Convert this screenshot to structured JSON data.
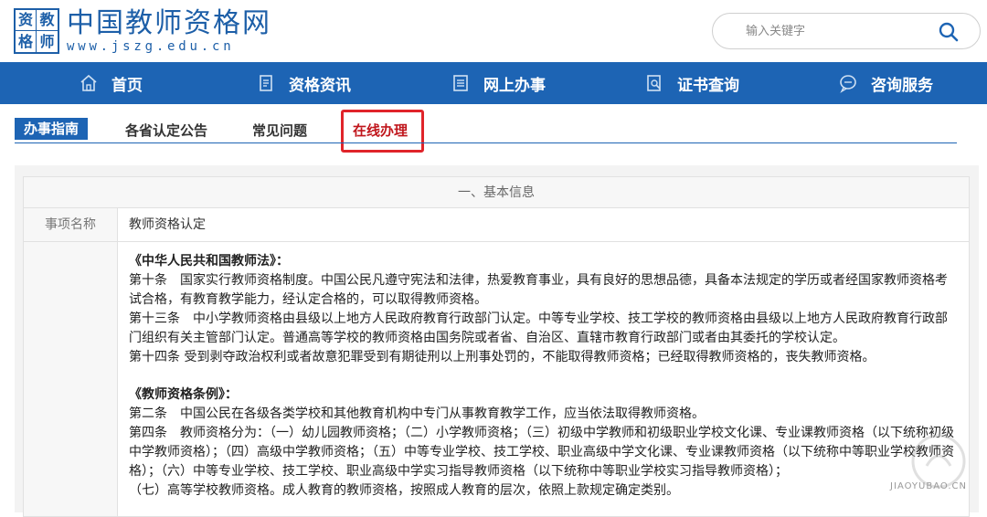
{
  "header": {
    "logo_chars": [
      "资",
      "教",
      "格",
      "师"
    ],
    "site_title": "中国教师资格网",
    "site_url": "www.jszg.edu.cn",
    "search_placeholder": "输入关键字"
  },
  "nav": {
    "items": [
      {
        "label": "首页",
        "icon": "home-icon"
      },
      {
        "label": "资格资讯",
        "icon": "document-icon"
      },
      {
        "label": "网上办事",
        "icon": "list-icon"
      },
      {
        "label": "证书查询",
        "icon": "search-document-icon"
      },
      {
        "label": "咨询服务",
        "icon": "chat-icon"
      }
    ]
  },
  "subtabs": {
    "items": [
      "办事指南",
      "各省认定公告",
      "常见问题",
      "在线办理"
    ],
    "active": "办事指南",
    "highlighted": "在线办理"
  },
  "section": {
    "title": "一、基本信息",
    "row1_label": "事项名称",
    "row1_value": "教师资格认定"
  },
  "legal_basis": {
    "law1_title": "《中华人民共和国教师法》：",
    "law1_p1": "第十条　国家实行教师资格制度。中国公民凡遵守宪法和法律，热爱教育事业，具有良好的思想品德，具备本法规定的学历或者经国家教师资格考试合格，有教育教学能力，经认定合格的，可以取得教师资格。",
    "law1_p2": "第十三条　中小学教师资格由县级以上地方人民政府教育行政部门认定。中等专业学校、技工学校的教师资格由县级以上地方人民政府教育行政部门组织有关主管部门认定。普通高等学校的教师资格由国务院或者省、自治区、直辖市教育行政部门或者由其委托的学校认定。",
    "law1_p3": "第十四条 受到剥夺政治权利或者故意犯罪受到有期徒刑以上刑事处罚的，不能取得教师资格；已经取得教师资格的，丧失教师资格。",
    "law2_title": "《教师资格条例》：",
    "law2_p1": "第二条　中国公民在各级各类学校和其他教育机构中专门从事教育教学工作，应当依法取得教师资格。",
    "law2_p2": "第四条　教师资格分为：（一）幼儿园教师资格；（二）小学教师资格；（三）初级中学教师和初级职业学校文化课、专业课教师资格（以下统称初级中学教师资格）；（四）高级中学教师资格；（五）中等专业学校、技工学校、职业高级中学文化课、专业课教师资格（以下统称中等职业学校教师资格）；（六）中等专业学校、技工学校、职业高级中学实习指导教师资格（以下统称中等职业学校实习指导教师资格）；",
    "law2_p3": "（七）高等学校教师资格。成人教育的教师资格，按照成人教育的层次，依照上款规定确定类别。"
  },
  "watermark": {
    "text": "JIAOYUBAO.CN"
  }
}
